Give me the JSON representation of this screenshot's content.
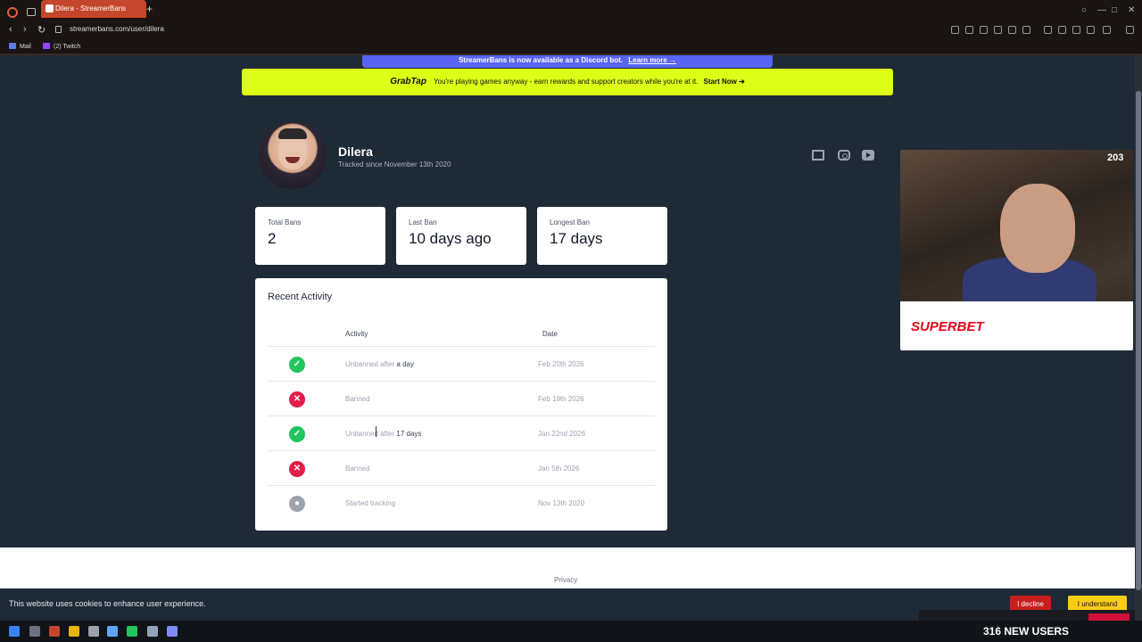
{
  "browser": {
    "tab_title": "Dilera - StreamerBans",
    "url": "streamerbans.com/user/dilera",
    "bookmarks": [
      {
        "label": "Mail"
      },
      {
        "label": "(2) Twitch"
      }
    ]
  },
  "banners": {
    "discord": {
      "text": "StreamerBans is now available as a Discord bot.",
      "link": "Learn more →"
    },
    "grabtap": {
      "logo": "GrabTap",
      "text": "You're playing games anyway - earn rewards and support creators while you're at it.",
      "cta": "Start Now ➜"
    }
  },
  "profile": {
    "name": "Dilera",
    "tracked_since": "Tracked since November 13th 2020",
    "socials": [
      "twitch-icon",
      "instagram-icon",
      "youtube-icon"
    ]
  },
  "stats": [
    {
      "label": "Total Bans",
      "value": "2"
    },
    {
      "label": "Last Ban",
      "value": "10 days ago"
    },
    {
      "label": "Longest Ban",
      "value": "17 days"
    }
  ],
  "recent_activity": {
    "title": "Recent Activity",
    "columns": {
      "activity": "Activity",
      "date": "Date"
    },
    "rows": [
      {
        "type": "unban",
        "prefix": "Unbanned after",
        "highlight": "a day",
        "date": "Feb 20th 2026"
      },
      {
        "type": "ban",
        "prefix": "Banned",
        "highlight": "",
        "date": "Feb 19th 2026"
      },
      {
        "type": "unban",
        "prefix": "Unbanned after",
        "highlight": "17 days",
        "date": "Jan 22nd 2026"
      },
      {
        "type": "ban",
        "prefix": "Banned",
        "highlight": "",
        "date": "Jan 5th 2026"
      },
      {
        "type": "tracking",
        "prefix": "Started tracking",
        "highlight": "",
        "date": "Nov 13th 2020"
      }
    ]
  },
  "footer": {
    "privacy": "Privacy"
  },
  "cookie_bar": {
    "message": "This website uses cookies to enhance user experience.",
    "decline": "I decline",
    "accept": "I understand"
  },
  "stream_overlay": {
    "viewers": "203",
    "sponsor": "SUPERBET",
    "new_users": "316 NEW USERS"
  },
  "colors": {
    "page_bg": "#1f2a37",
    "grabtap_bg": "#dcff17",
    "discord_bg": "#5865f2",
    "unban": "#22c55e",
    "ban": "#e11d48",
    "decline": "#c81e1e",
    "accept": "#facc15"
  }
}
